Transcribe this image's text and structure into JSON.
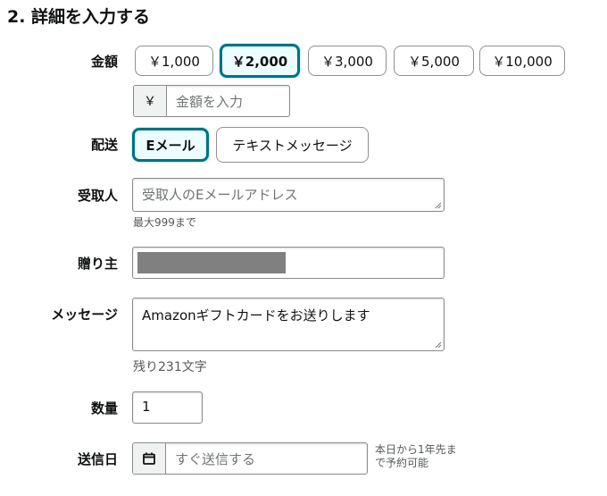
{
  "section": {
    "title": "2. 詳細を入力する"
  },
  "amount": {
    "label": "金額",
    "options": [
      "￥1,000",
      "￥2,000",
      "￥3,000",
      "￥5,000",
      "￥10,000"
    ],
    "selected": "￥2,000",
    "currency_prefix": "￥",
    "custom_placeholder": "金額を入力"
  },
  "delivery": {
    "label": "配送",
    "options": [
      "Eメール",
      "テキストメッセージ"
    ],
    "selected": "Eメール"
  },
  "recipient": {
    "label": "受取人",
    "placeholder": "受取人のEメールアドレス",
    "hint": "最大999まで"
  },
  "sender": {
    "label": "贈り主"
  },
  "message": {
    "label": "メッセージ",
    "value": "Amazonギフトカードをお送りします",
    "remaining": "残り231文字"
  },
  "quantity": {
    "label": "数量",
    "value": "1"
  },
  "send_date": {
    "label": "送信日",
    "placeholder": "すぐ送信する",
    "note_line1": "本日から1年先ま",
    "note_line2": "で予約可能",
    "icon": "calendar-icon"
  },
  "colors": {
    "accent": "#007185",
    "selected_bg": "#edfdff",
    "redaction": "#808080"
  }
}
